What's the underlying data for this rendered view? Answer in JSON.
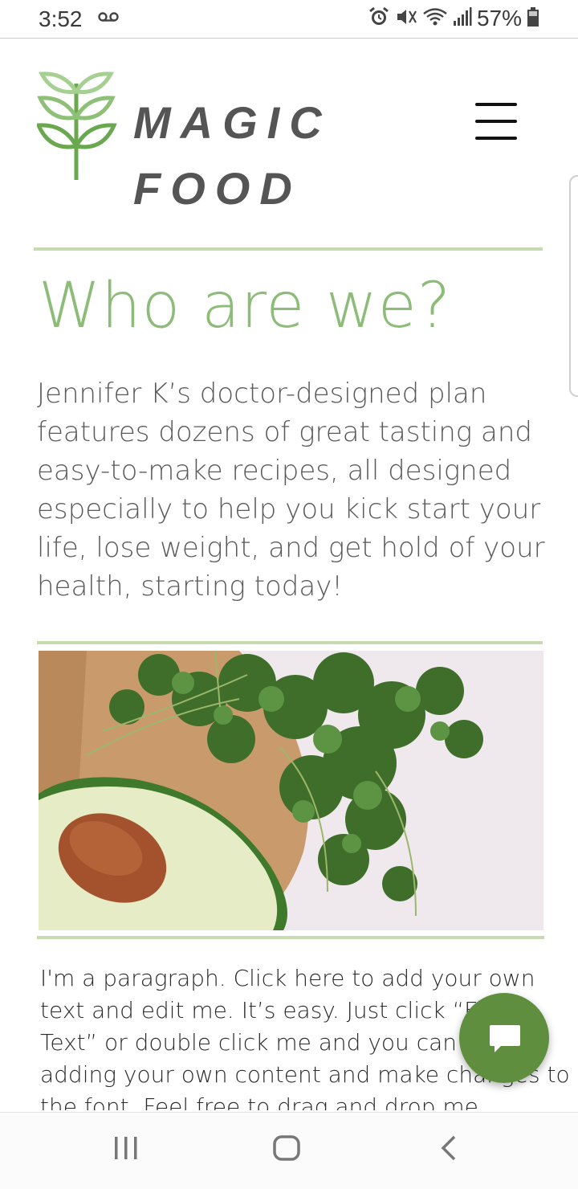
{
  "status_bar": {
    "time": "3:52",
    "battery_percent": "57%",
    "icons": [
      "voicemail-icon",
      "alarm-icon",
      "mute-icon",
      "wifi-icon",
      "signal-icon",
      "battery-icon"
    ]
  },
  "header": {
    "brand_line1": "MAGIC",
    "brand_line2": "FOOD",
    "logo_icon": "wheat-leaf-icon",
    "menu_icon": "hamburger-menu-icon"
  },
  "main": {
    "heading": "Who are we?",
    "intro": "Jennifer K’s doctor-designed plan features dozens of great tasting and easy-to-make recipes, all designed especially to help you kick start your life, lose weight, and get hold of your health, starting today!",
    "paragraph": "I'm a paragraph. Click here to add your own text and edit me. It’s easy. Just click “Edit Text” or double click me and you can start adding your own content and make changes to the font. Feel free to drag and drop me anywhere you like on your page."
  },
  "chat": {
    "icon": "chat-bubble-icon"
  },
  "colors": {
    "accent_green": "#8cbc78",
    "divider_green": "#c6dcb0",
    "brand_gray": "#555555",
    "fab_green": "#5f8f3e"
  },
  "nav_bar": {
    "icons": [
      "recents-icon",
      "home-icon",
      "back-icon"
    ]
  }
}
